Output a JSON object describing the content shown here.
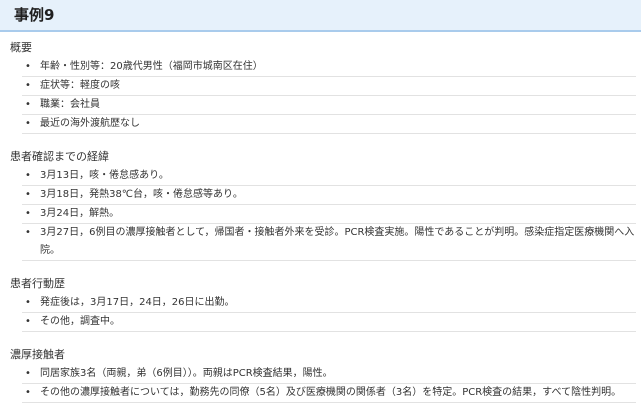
{
  "page": {
    "title": "事例9"
  },
  "icons": {
    "bullet": "bullet-icon"
  },
  "colors": {
    "header_bg": "#e6f1fb",
    "header_border": "#a9cbec",
    "divider": "#e2e2e2",
    "text": "#333333"
  },
  "sections": [
    {
      "heading": "概要",
      "items": [
        "年齢・性別等：20歳代男性（福岡市城南区在住）",
        "症状等：軽度の咳",
        "職業：会社員",
        "最近の海外渡航歴なし"
      ]
    },
    {
      "heading": "患者確認までの経緯",
      "items": [
        "3月13日，咳・倦怠感あり。",
        "3月18日，発熱38℃台，咳・倦怠感等あり。",
        "3月24日，解熱。",
        "3月27日，6例目の濃厚接触者として，帰国者・接触者外来を受診。PCR検査実施。陽性であることが判明。感染症指定医療機関へ入院。"
      ]
    },
    {
      "heading": "患者行動歴",
      "items": [
        "発症後は，3月17日，24日，26日に出勤。",
        "その他，調査中。"
      ]
    },
    {
      "heading": "濃厚接触者",
      "items": [
        "同居家族3名（両親，弟（6例目））。両親はPCR検査結果，陽性。",
        "その他の濃厚接触者については，勤務先の同僚（5名）及び医療機関の関係者（3名）を特定。PCR検査の結果，すべて陰性判明。"
      ]
    }
  ]
}
